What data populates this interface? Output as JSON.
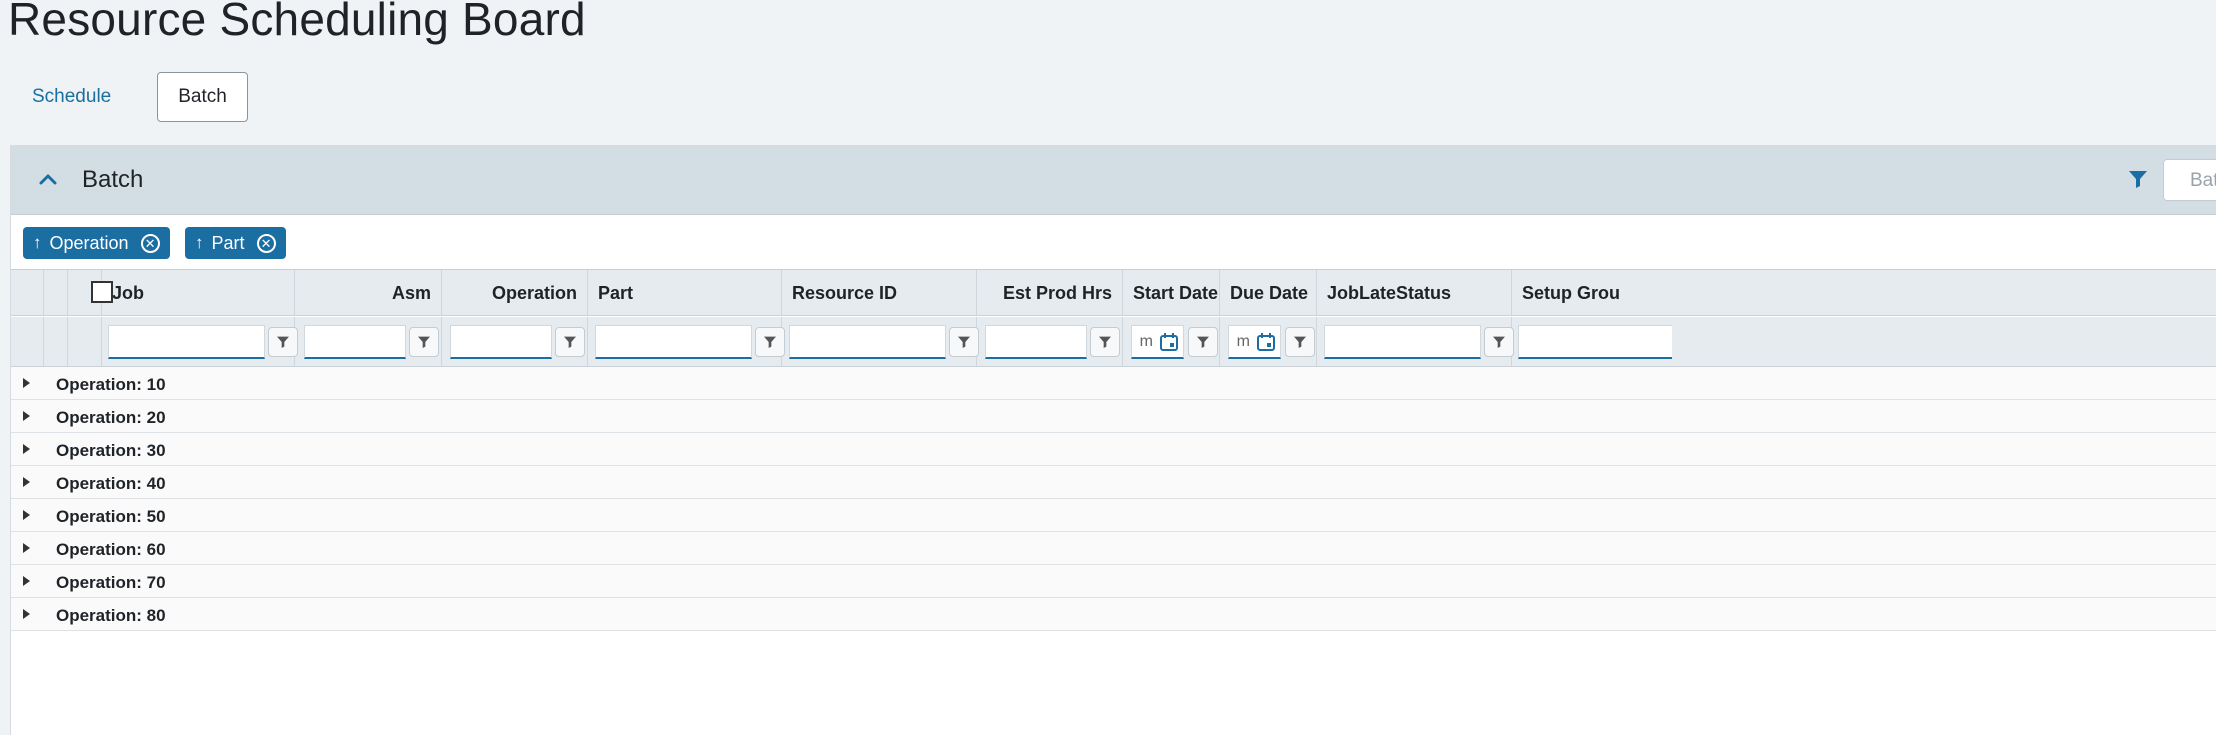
{
  "page": {
    "title": "Resource Scheduling Board"
  },
  "tabs": {
    "schedule": "Schedule",
    "batch": "Batch"
  },
  "panel": {
    "title": "Batch",
    "search_placeholder": "Bat"
  },
  "group_chips": [
    {
      "arrow": "↑",
      "label": "Operation"
    },
    {
      "arrow": "↑",
      "label": "Part"
    }
  ],
  "columns": [
    {
      "label": "Job"
    },
    {
      "label": "Asm"
    },
    {
      "label": "Operation"
    },
    {
      "label": "Part"
    },
    {
      "label": "Resource ID"
    },
    {
      "label": "Est Prod Hrs"
    },
    {
      "label": "Start Date"
    },
    {
      "label": "Due Date"
    },
    {
      "label": "JobLateStatus"
    },
    {
      "label": "Setup Grou"
    }
  ],
  "date_placeholder": "m",
  "groups": [
    {
      "label": "Operation: 10"
    },
    {
      "label": "Operation: 20"
    },
    {
      "label": "Operation: 30"
    },
    {
      "label": "Operation: 40"
    },
    {
      "label": "Operation: 50"
    },
    {
      "label": "Operation: 60"
    },
    {
      "label": "Operation: 70"
    },
    {
      "label": "Operation: 80"
    }
  ],
  "colors": {
    "accent": "#1b6ea2",
    "header_bg": "#d3dee4",
    "page_bg": "#eff3f6"
  }
}
